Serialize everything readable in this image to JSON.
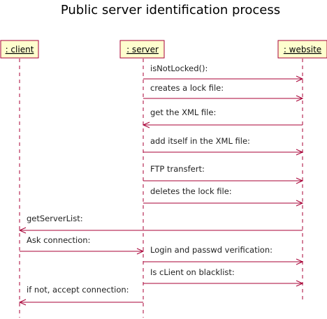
{
  "diagram": {
    "title": "Public server identification process",
    "participants": [
      {
        "id": "client",
        "label": " : client"
      },
      {
        "id": "server",
        "label": " : server"
      },
      {
        "id": "website",
        "label": " : website"
      }
    ],
    "messages": [
      {
        "from": "server",
        "to": "website",
        "label": "isNotLocked():"
      },
      {
        "from": "server",
        "to": "website",
        "label": "creates a lock file:"
      },
      {
        "from": "website",
        "to": "server",
        "label": "get the XML file:"
      },
      {
        "from": "server",
        "to": "website",
        "label": "add itself in the XML file:"
      },
      {
        "from": "server",
        "to": "website",
        "label": "FTP transfert:"
      },
      {
        "from": "server",
        "to": "website",
        "label": "deletes the lock file:"
      },
      {
        "from": "website",
        "to": "client",
        "label": "getServerList:"
      },
      {
        "from": "client",
        "to": "server",
        "label": "Ask connection:"
      },
      {
        "from": "server",
        "to": "website",
        "label": "Login and passwd verification:"
      },
      {
        "from": "server",
        "to": "website",
        "label": "Is cLient on blacklist:"
      },
      {
        "from": "server",
        "to": "client",
        "label": "if not, accept connection:"
      }
    ]
  }
}
